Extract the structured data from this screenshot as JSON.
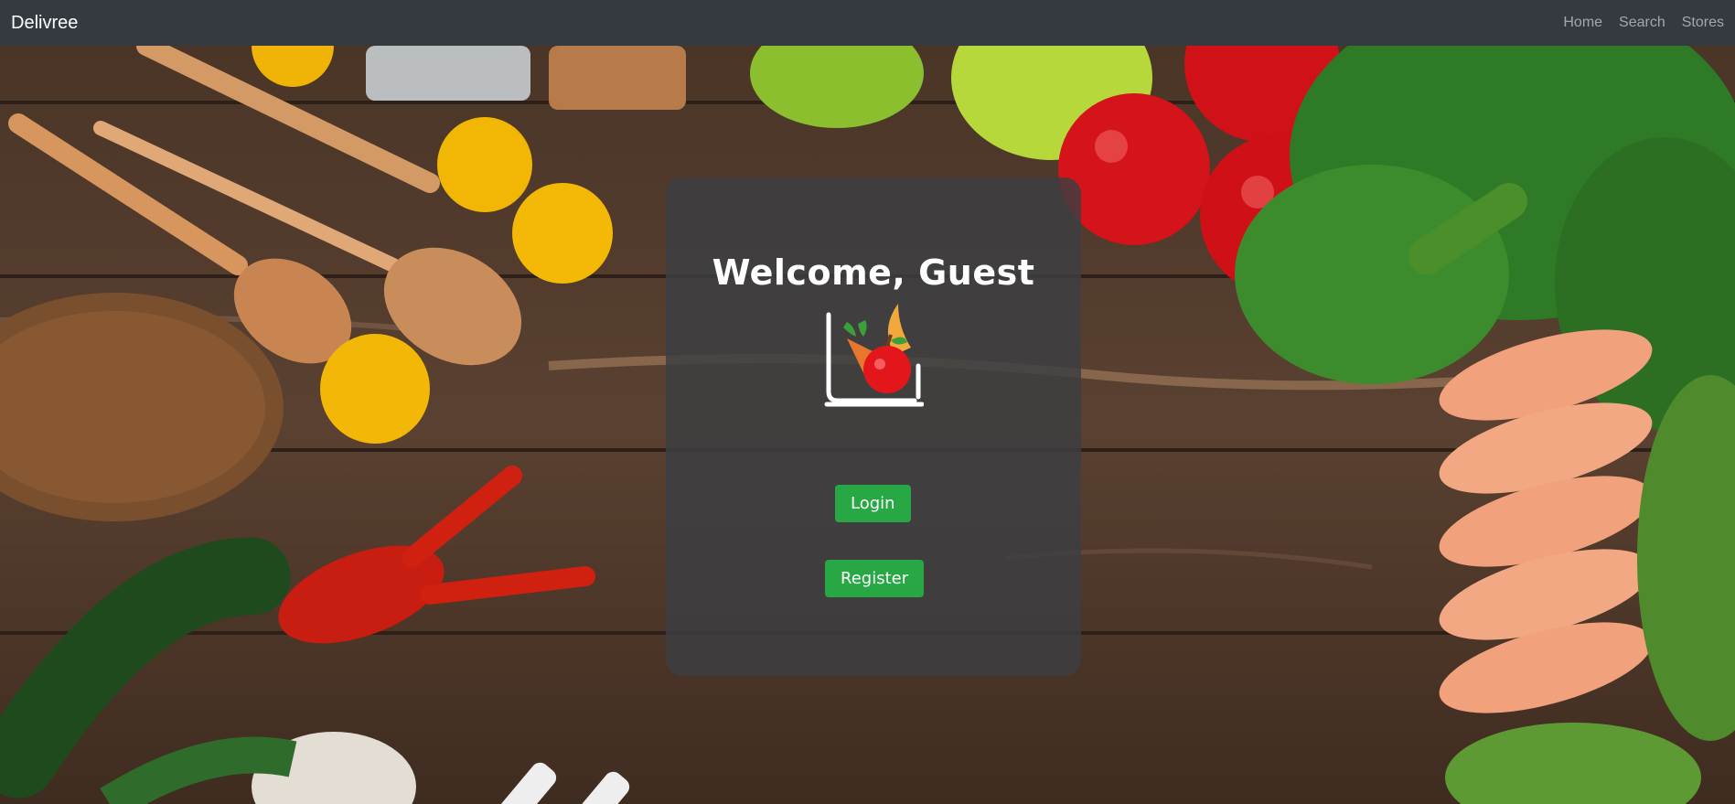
{
  "navbar": {
    "brand": "Delivree",
    "links": [
      "Home",
      "Search",
      "Stores"
    ]
  },
  "card": {
    "welcome": "Welcome, Guest",
    "login_label": "Login",
    "register_label": "Register"
  },
  "colors": {
    "navbar_bg": "#343a40",
    "button_green": "#28a745",
    "card_bg": "rgba(60,62,66,0.82)"
  }
}
